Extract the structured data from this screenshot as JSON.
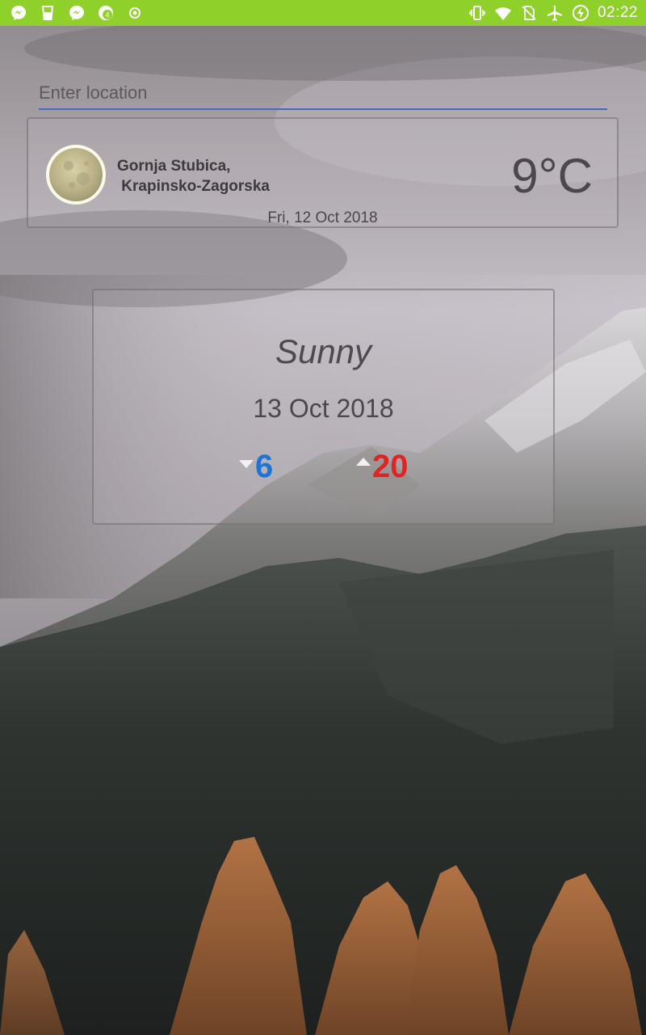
{
  "status_bar": {
    "left_icons": [
      "messenger-icon",
      "glass-icon",
      "messenger-icon",
      "notification-count-icon",
      "target-icon"
    ],
    "notification_count": "4",
    "right_icons": [
      "vibrate-icon",
      "wifi-icon",
      "no-sim-icon",
      "airplane-icon",
      "battery-charging-icon"
    ],
    "time": "02:22",
    "background_color": "#8fd12a"
  },
  "search": {
    "placeholder": "Enter location",
    "value": ""
  },
  "current": {
    "location": "Gornja Stubica,\n Krapinsko-Zagorska",
    "temperature": "9°C",
    "date": "Fri, 12 Oct 2018",
    "icon": "moon-icon"
  },
  "forecast": {
    "condition": "Sunny",
    "date": "13 Oct 2018",
    "min": "6",
    "max": "20",
    "min_color": "#1e73d6",
    "max_color": "#e02424"
  }
}
